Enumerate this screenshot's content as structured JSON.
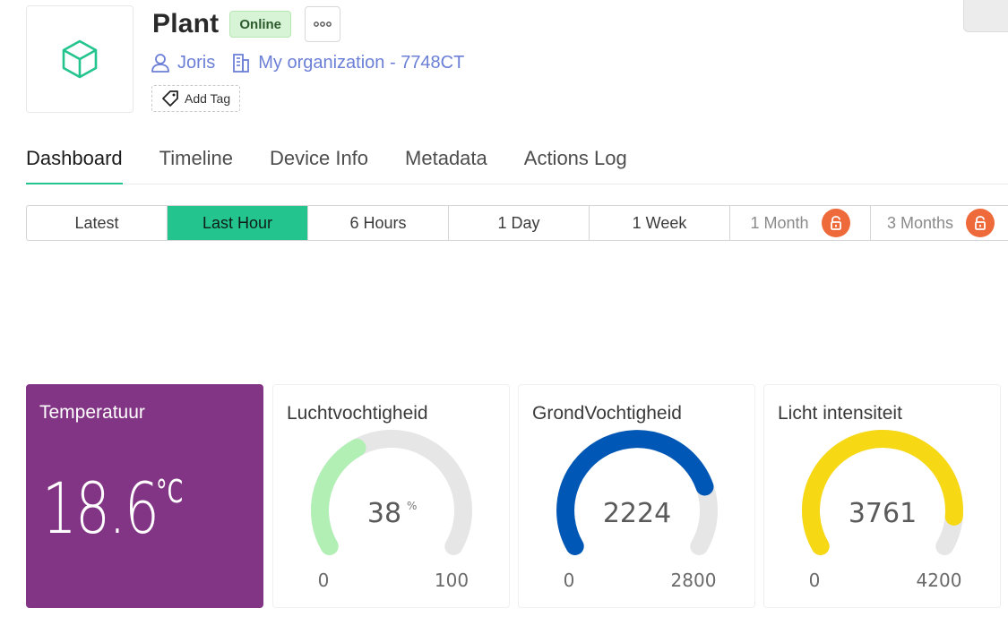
{
  "device": {
    "title": "Plant",
    "status": "Online",
    "owner": "Joris",
    "organization": "My organization - 7748CT",
    "add_tag_label": "Add Tag"
  },
  "tabs": [
    {
      "label": "Dashboard",
      "active": true
    },
    {
      "label": "Timeline",
      "active": false
    },
    {
      "label": "Device Info",
      "active": false
    },
    {
      "label": "Metadata",
      "active": false
    },
    {
      "label": "Actions Log",
      "active": false
    }
  ],
  "time_ranges": [
    {
      "label": "Latest",
      "active": false,
      "locked": false
    },
    {
      "label": "Last Hour",
      "active": true,
      "locked": false
    },
    {
      "label": "6 Hours",
      "active": false,
      "locked": false
    },
    {
      "label": "1 Day",
      "active": false,
      "locked": false
    },
    {
      "label": "1 Week",
      "active": false,
      "locked": false
    },
    {
      "label": "1 Month",
      "active": false,
      "locked": true
    },
    {
      "label": "3 Months",
      "active": false,
      "locked": true
    }
  ],
  "widgets": {
    "temperature": {
      "title": "Temperatuur",
      "value": "18.6",
      "unit": "°C",
      "color": "#833585"
    },
    "humidity": {
      "title": "Luchtvochtigheid",
      "value": "38",
      "unit": "%",
      "min": "0",
      "max": "100",
      "level": 38,
      "range": 100,
      "color": "#b2efb5"
    },
    "soil": {
      "title": "GrondVochtigheid",
      "value": "2224",
      "unit": "",
      "min": "0",
      "max": "2800",
      "level": 2224,
      "range": 2800,
      "color": "#0057b5"
    },
    "light": {
      "title": "Licht intensiteit",
      "value": "3761",
      "unit": "",
      "min": "0",
      "max": "4200",
      "level": 3761,
      "range": 4200,
      "color": "#f7d814"
    }
  },
  "icons": {
    "device": "cube-icon",
    "more": "more-icon",
    "owner": "user-icon",
    "organization": "building-icon",
    "tag": "tag-icon",
    "lock": "lock-icon"
  },
  "colors": {
    "accent": "#23c48e",
    "link": "#6b7fd6",
    "lock": "#ef6a3a",
    "gauge_track": "#e6e6e6"
  }
}
